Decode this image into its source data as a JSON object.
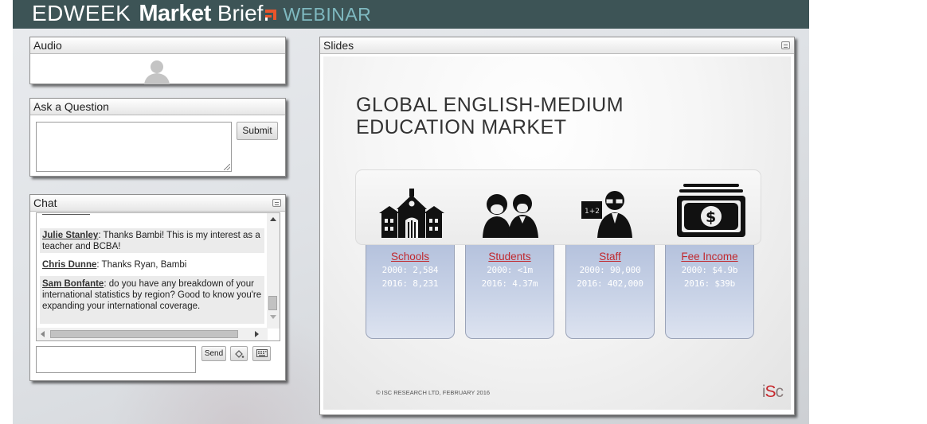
{
  "header": {
    "brand_edweek": "EDWEEK",
    "brand_market": "Market",
    "brand_brief": "Brief",
    "brand_webinar": "WEBINAR",
    "color_bg": "#3d5456",
    "color_accent": "#e9552b"
  },
  "audio": {
    "title": "Audio",
    "icon": "user-silhouette-icon"
  },
  "ask": {
    "title": "Ask a Question",
    "input_value": "",
    "submit_label": "Submit"
  },
  "chat": {
    "title": "Chat",
    "messages": [
      {
        "author": "Julie Stanley",
        "text": ": Thanks Bambi! This is my interest as a teacher and BCBA!"
      },
      {
        "author": "Chris Dunne",
        "text": ": Thanks Ryan, Bambi"
      },
      {
        "author": "Sam Bonfante",
        "text": ": do you have any breakdown of your international statistics by region? Good to know you're expanding your international coverage."
      }
    ],
    "input_value": "",
    "send_label": "Send",
    "emoji_icon": "paint-bucket-icon",
    "keyboard_icon": "keyboard-icon"
  },
  "slides": {
    "title": "Slides",
    "slide_title_line1": "GLOBAL ENGLISH-MEDIUM",
    "slide_title_line2": "EDUCATION MARKET",
    "cards": [
      {
        "label": "Schools",
        "v2000": "2000: 2,584",
        "v2016": "2016: 8,231",
        "icon": "school-building-icon"
      },
      {
        "label": "Students",
        "v2000": "2000: <1m",
        "v2016": "2016: 4.37m",
        "icon": "students-icon"
      },
      {
        "label": "Staff",
        "v2000": "2000: 90,000",
        "v2016": "2016: 402,000",
        "icon": "teacher-icon"
      },
      {
        "label": "Fee Income",
        "v2000": "2000: $4.9b",
        "v2016": "2016: $39b",
        "icon": "money-icon"
      }
    ],
    "copyright": "© ISC RESEARCH LTD, FEBRUARY 2016",
    "logo_prefix": "i",
    "logo_s": "S",
    "logo_suffix": "c"
  }
}
